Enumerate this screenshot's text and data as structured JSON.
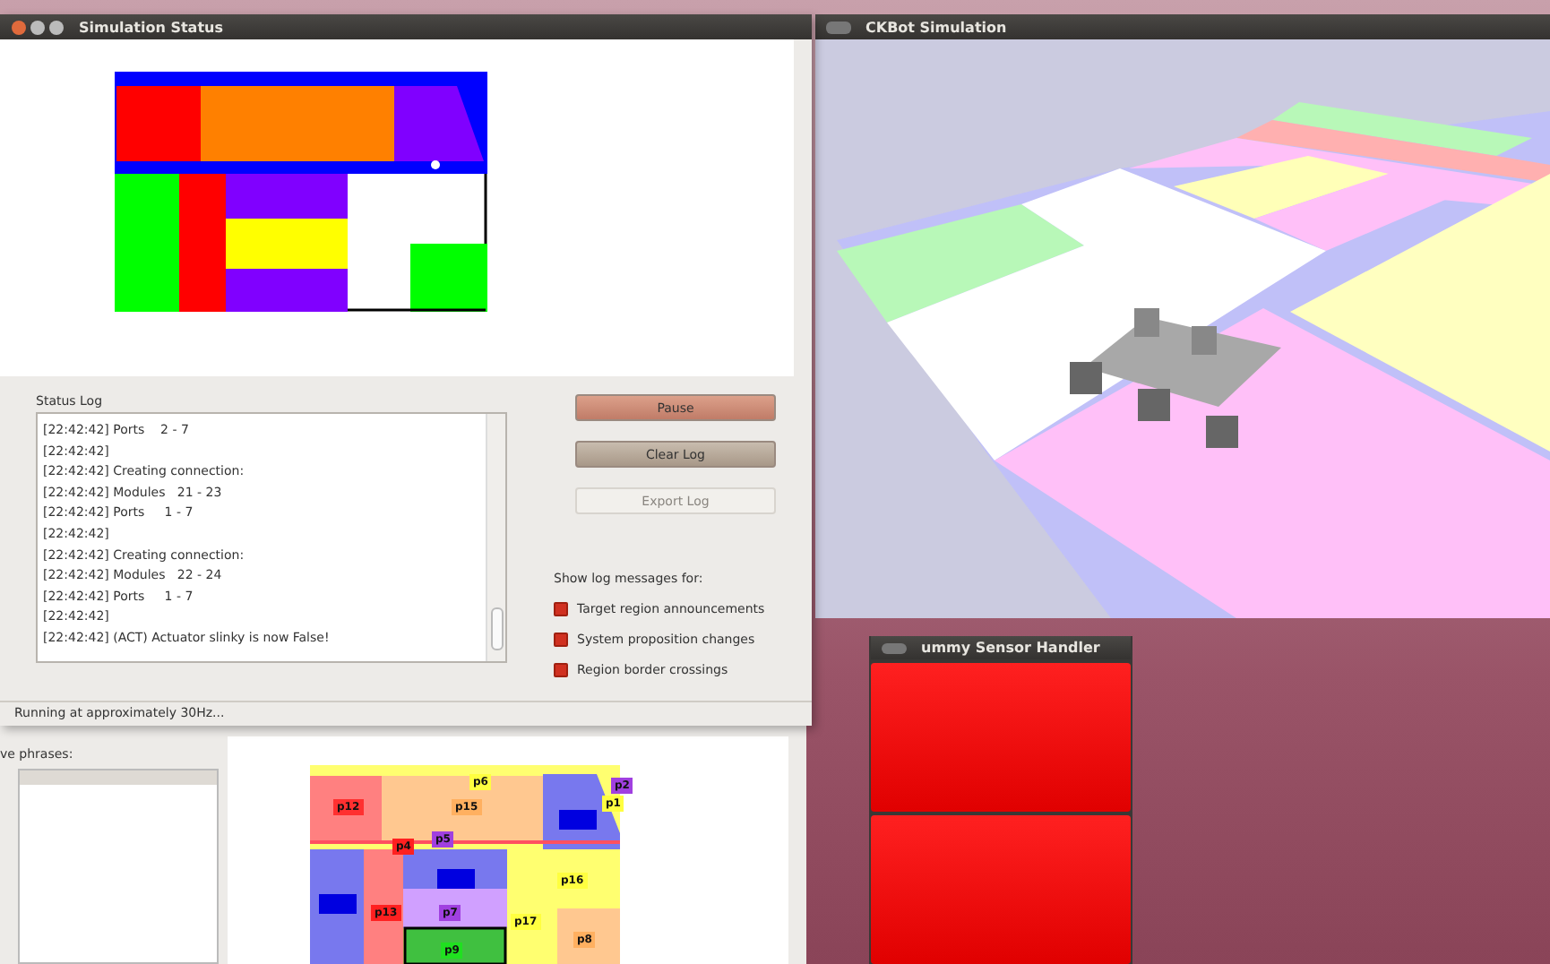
{
  "simulation_window": {
    "title": "Simulation Status",
    "status_log": {
      "label": "Status Log",
      "lines": [
        "[22:42:42] Ports    2 - 7",
        "[22:42:42]",
        "[22:42:42] Creating connection:",
        "[22:42:42] Modules   21 - 23",
        "[22:42:42] Ports     1 - 7",
        "[22:42:42]",
        "[22:42:42] Creating connection:",
        "[22:42:42] Modules   22 - 24",
        "[22:42:42] Ports     1 - 7",
        "[22:42:42]",
        "[22:42:42] (ACT) Actuator slinky is now False!"
      ]
    },
    "buttons": [
      {
        "label": "Pause",
        "kind": "pause",
        "disabled": false
      },
      {
        "label": "Clear Log",
        "kind": "plain",
        "disabled": false
      },
      {
        "label": "Export Log",
        "kind": "plain",
        "disabled": true
      }
    ],
    "log_filters": {
      "label": "Show log messages for:",
      "options": [
        {
          "label": "Target region announcements",
          "checked": true
        },
        {
          "label": "System proposition changes",
          "checked": true
        },
        {
          "label": "Region border crossings",
          "checked": true
        }
      ]
    },
    "status_bar": "Running at approximately 30Hz..."
  },
  "editor_window": {
    "list_label": "ve phrases:",
    "regions": [
      {
        "label": "p6",
        "color": "#ffff40"
      },
      {
        "label": "p12",
        "color": "#ff3030"
      },
      {
        "label": "p15",
        "color": "#ffb060"
      },
      {
        "label": "p2",
        "color": "#a040e0"
      },
      {
        "label": "p1",
        "color": "#ffff40"
      },
      {
        "label": "p4",
        "color": "#ff2020"
      },
      {
        "label": "p5",
        "color": "#a040e0"
      },
      {
        "label": "p16",
        "color": "#ffff40"
      },
      {
        "label": "p13",
        "color": "#ff2020"
      },
      {
        "label": "p7",
        "color": "#a040e0"
      },
      {
        "label": "p17",
        "color": "#ffff40"
      },
      {
        "label": "p8",
        "color": "#ffb060"
      },
      {
        "label": "p9",
        "color": "#20e020"
      }
    ]
  },
  "ckbot_window": {
    "title": "CKBot Simulation"
  },
  "sensor_window": {
    "title": "ummy Sensor Handler",
    "sensors": [
      {
        "on": false
      },
      {
        "on": false
      }
    ]
  }
}
